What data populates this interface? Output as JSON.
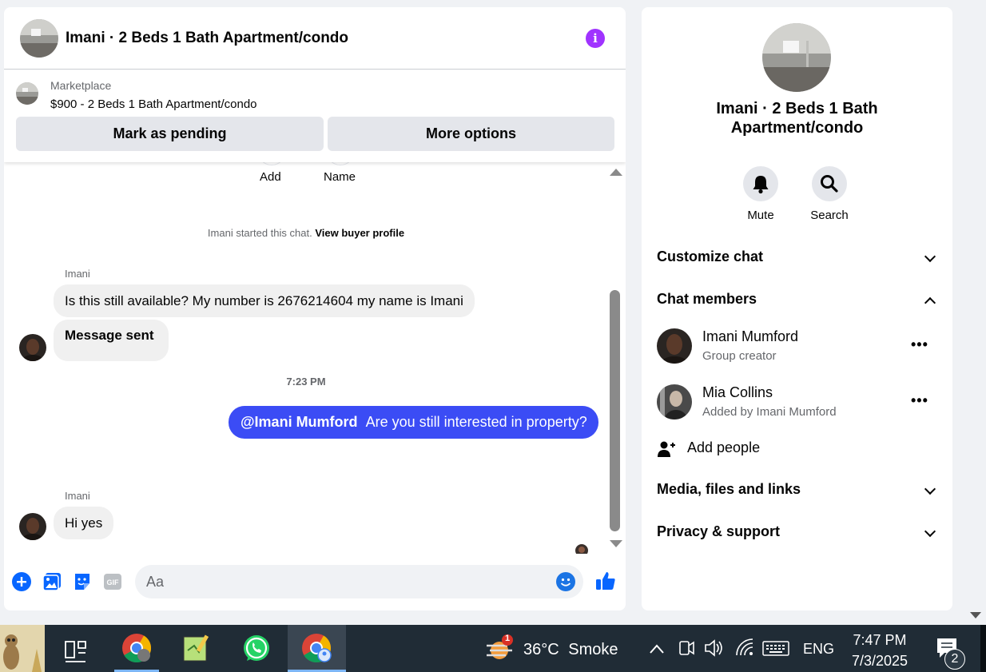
{
  "chat": {
    "title": "Imani · 2 Beds 1 Bath Apartment/condo",
    "marketplace": {
      "label": "Marketplace",
      "listing": "$900 - 2 Beds 1 Bath Apartment/condo",
      "mark_pending": "Mark as pending",
      "more_options": "More options"
    },
    "top_actions": [
      "Add",
      "Name"
    ],
    "system_note": "Imani started this chat.",
    "system_link": "View buyer profile",
    "messages": [
      {
        "sender": "Imani",
        "text": "Is this still available? My number is 2676214604 my name is Imani"
      },
      {
        "text": "Message sent"
      },
      {
        "timestamp": "7:23 PM"
      },
      {
        "mention": "@Imani Mumford",
        "text": "Are you still interested in property?"
      },
      {
        "sender": "Imani",
        "text": "Hi yes"
      }
    ],
    "composer_placeholder": "Aa"
  },
  "info": {
    "title": "Imani · 2 Beds 1 Bath Apartment/condo",
    "actions": [
      "Mute",
      "Search"
    ],
    "sections": {
      "customize": "Customize chat",
      "members": "Chat members",
      "media": "Media, files and links",
      "privacy": "Privacy & support"
    },
    "members": [
      {
        "name": "Imani Mumford",
        "role": "Group creator"
      },
      {
        "name": "Mia Collins",
        "role": "Added by Imani Mumford"
      }
    ],
    "add_people": "Add people",
    "more_glyph": "•••"
  },
  "taskbar": {
    "weather_temp": "36°C",
    "weather_cond": "Smoke",
    "weather_badge": "1",
    "language": "ENG",
    "time": "7:47 PM",
    "date": "7/3/2025",
    "notifications": "2"
  },
  "colors": {
    "accent": "#0866ff",
    "outgoing_bubble": "#3b4cf5",
    "info_icon": "#a033ff",
    "taskbar": "#202c36"
  },
  "icons": [
    "info-icon",
    "plus-icon",
    "photo-icon",
    "sticker-icon",
    "gif-icon",
    "emoji-icon",
    "like-icon",
    "bell-icon",
    "search-icon",
    "chevron-down-icon",
    "chevron-up-icon",
    "add-person-icon",
    "more-icon",
    "task-view-icon",
    "chrome-icon",
    "whatsapp-icon",
    "notepad-icon",
    "weather-icon",
    "wifi-icon",
    "volume-icon",
    "keyboard-icon",
    "notification-icon"
  ]
}
